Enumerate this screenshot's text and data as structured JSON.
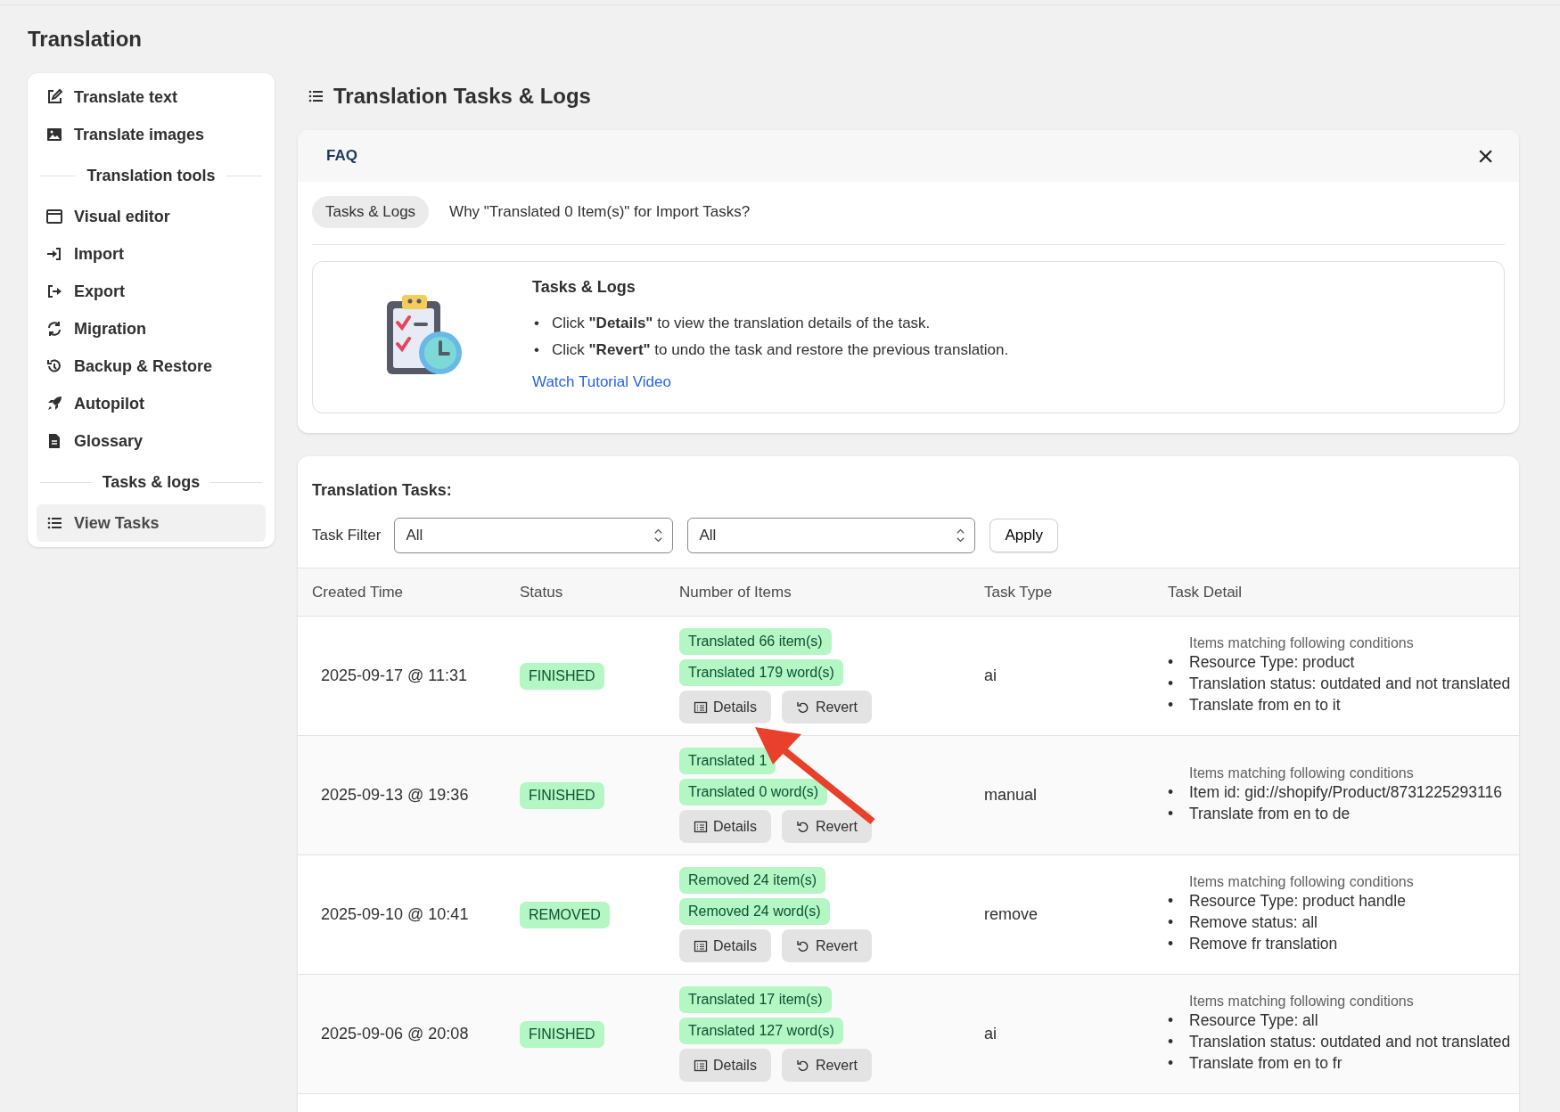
{
  "page_title": "Translation",
  "sidebar": {
    "items": [
      {
        "kind": "link",
        "label": "Translate text",
        "selected": false
      },
      {
        "kind": "link",
        "label": "Translate images",
        "selected": false
      },
      {
        "kind": "heading",
        "label": "Translation tools"
      },
      {
        "kind": "link",
        "label": "Visual editor",
        "selected": false
      },
      {
        "kind": "link",
        "label": "Import",
        "selected": false
      },
      {
        "kind": "link",
        "label": "Export",
        "selected": false
      },
      {
        "kind": "link",
        "label": "Migration",
        "selected": false
      },
      {
        "kind": "link",
        "label": "Backup & Restore",
        "selected": false
      },
      {
        "kind": "link",
        "label": "Autopilot",
        "selected": false
      },
      {
        "kind": "link",
        "label": "Glossary",
        "selected": false
      },
      {
        "kind": "heading",
        "label": "Tasks & logs"
      },
      {
        "kind": "link",
        "label": "View Tasks",
        "selected": true
      }
    ]
  },
  "main_title": "Translation Tasks & Logs",
  "faq": {
    "title": "FAQ",
    "close": "×",
    "tabs": [
      {
        "label": "Tasks & Logs",
        "selected": true
      },
      {
        "label": "Why \"Translated 0 Item(s)\" for Import Tasks?",
        "selected": false
      }
    ],
    "card": {
      "heading": "Tasks & Logs",
      "bullets": [
        {
          "marker": "•",
          "text": "Click **\"Details\"** to view the translation details of the task."
        },
        {
          "marker": "•",
          "text": "Click **\"Revert\"** to undo the task and restore the previous translation."
        }
      ],
      "link": "Watch Tutorial Video"
    }
  },
  "tasks": {
    "title": "Translation Tasks:",
    "filter_label": "Task Filter",
    "filters": [
      {
        "value": "All"
      },
      {
        "value": "All"
      }
    ],
    "apply": "Apply",
    "columns": [
      "Created Time",
      "Status",
      "Number of Items",
      "Task Type",
      "Task Detail"
    ],
    "rows": [
      {
        "created": "2025-09-17 @ 11:31",
        "status": "FINISHED",
        "counts": [
          "Translated 66 item(s)",
          "Translated 179 word(s)"
        ],
        "actions": [
          "Details",
          "Revert"
        ],
        "task_type": "ai",
        "detail_heading": "Items matching following conditions",
        "conditions": [
          {
            "marker": "•",
            "text": "Resource Type: product"
          },
          {
            "marker": "•",
            "text": "Translation status: outdated and not translated"
          },
          {
            "marker": "•",
            "text": "Translate from en to it"
          }
        ]
      },
      {
        "created": "2025-09-13 @ 19:36",
        "status": "FINISHED",
        "counts": [
          "Translated 1",
          "Translated 0 word(s)"
        ],
        "actions": [
          "Details",
          "Revert"
        ],
        "task_type": "manual",
        "detail_heading": "Items matching following conditions",
        "conditions": [
          {
            "marker": "•",
            "text": "Item id: gid://shopify/Product/8731225293116"
          },
          {
            "marker": "•",
            "text": "Translate from en to de"
          }
        ]
      },
      {
        "created": "2025-09-10 @ 10:41",
        "status": "REMOVED",
        "counts": [
          "Removed 24 item(s)",
          "Removed 24 word(s)"
        ],
        "actions": [
          "Details",
          "Revert"
        ],
        "task_type": "remove",
        "detail_heading": "Items matching following conditions",
        "conditions": [
          {
            "marker": "•",
            "text": "Resource Type: product handle"
          },
          {
            "marker": "•",
            "text": "Remove status: all"
          },
          {
            "marker": "•",
            "text": "Remove fr translation"
          }
        ]
      },
      {
        "created": "2025-09-06 @ 20:08",
        "status": "FINISHED",
        "counts": [
          "Translated 17 item(s)",
          "Translated 127 word(s)"
        ],
        "actions": [
          "Details",
          "Revert"
        ],
        "task_type": "ai",
        "detail_heading": "Items matching following conditions",
        "conditions": [
          {
            "marker": "•",
            "text": "Resource Type: all"
          },
          {
            "marker": "•",
            "text": "Translation status: outdated and not translated"
          },
          {
            "marker": "•",
            "text": "Translate from en to fr"
          }
        ]
      }
    ]
  }
}
